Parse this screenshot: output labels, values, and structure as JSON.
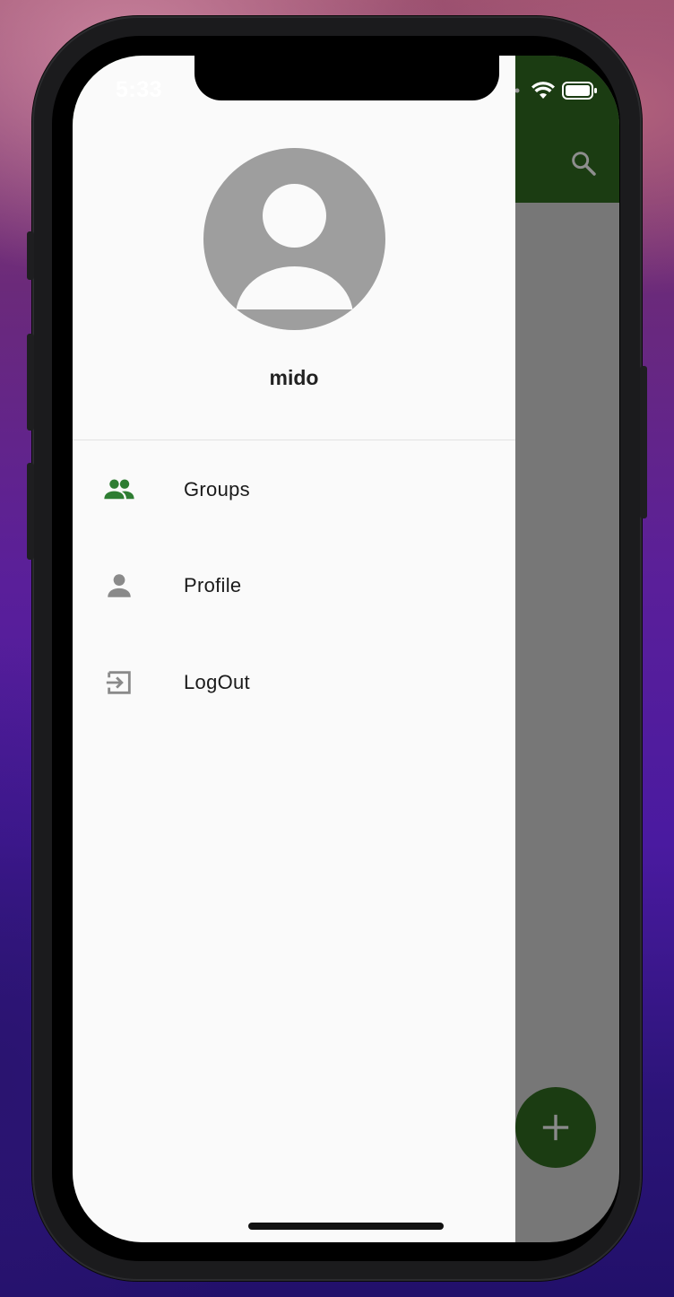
{
  "status_bar": {
    "time": "5:33",
    "icons": [
      "signal-icon",
      "wifi-icon",
      "battery-icon"
    ]
  },
  "drawer": {
    "username": "mido",
    "avatar_icon": "account-circle-icon",
    "menu": [
      {
        "label": "Groups",
        "icon": "groups-icon",
        "icon_color": "#2e7d32"
      },
      {
        "label": "Profile",
        "icon": "person-icon",
        "icon_color": "#8a8a8a"
      },
      {
        "label": "LogOut",
        "icon": "logout-icon",
        "icon_color": "#8a8a8a"
      }
    ]
  },
  "background_app": {
    "appbar_color": "#1b3c12",
    "scrim_color": "#777777",
    "search_icon": "search-icon",
    "fab_icon": "add-icon"
  }
}
